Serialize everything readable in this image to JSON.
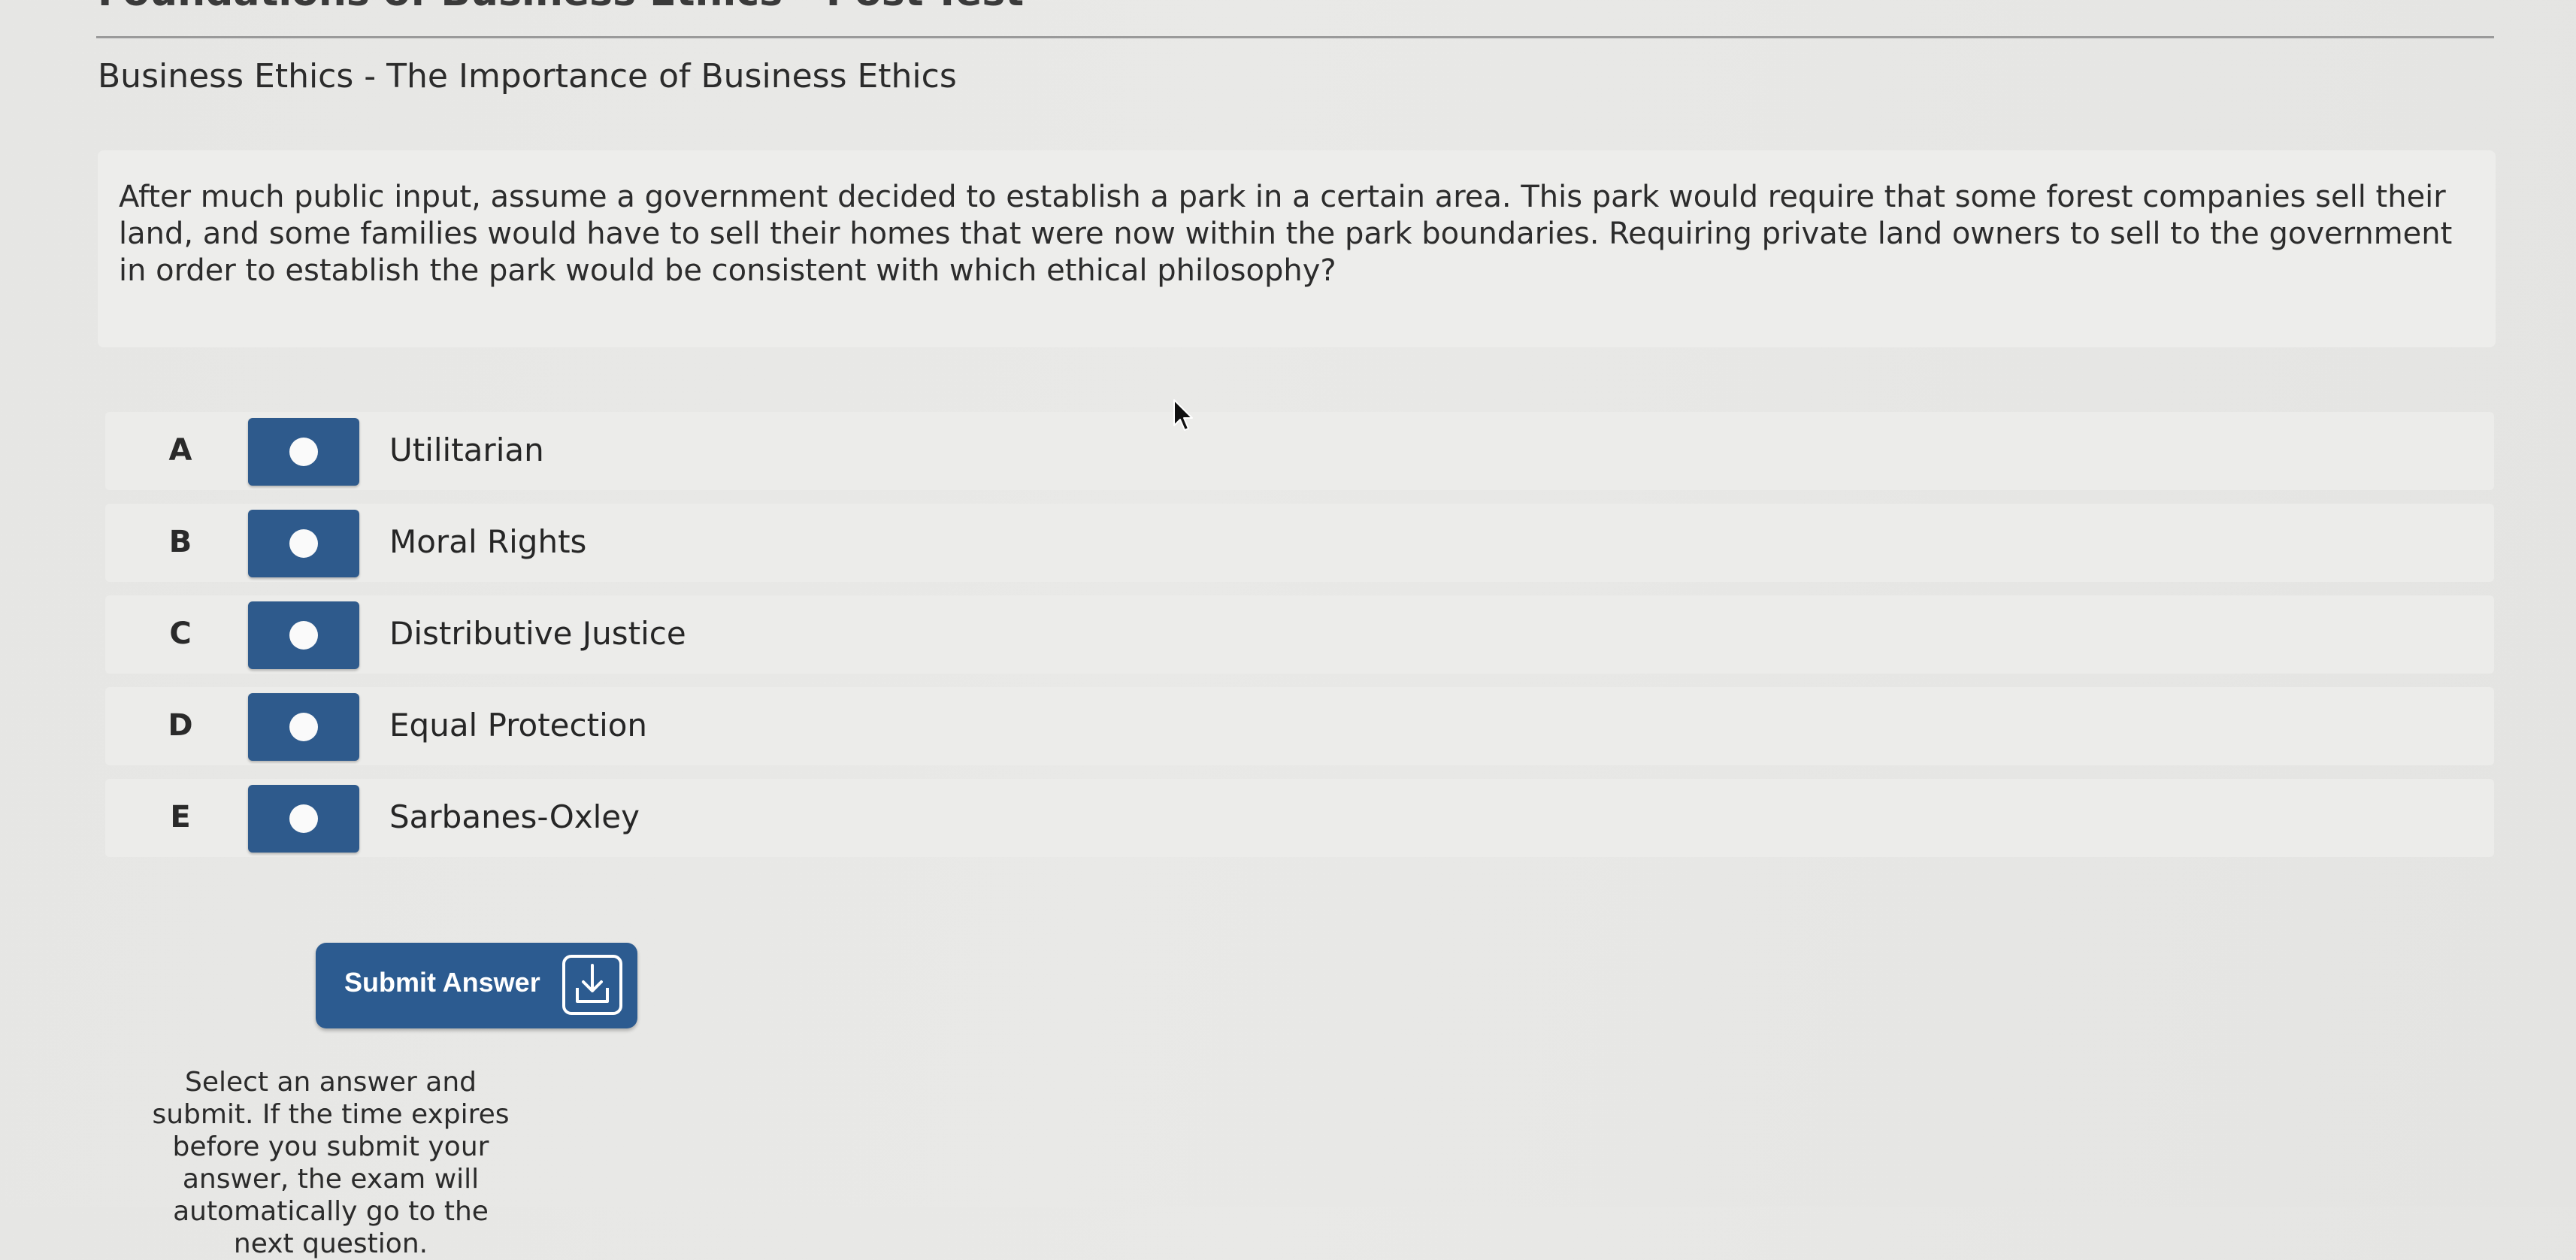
{
  "header": {
    "exam_title": "Foundations of Business Ethics - Post-Test",
    "section_title": "Business Ethics - The Importance of Business Ethics"
  },
  "question": {
    "text": "After much public input, assume a government decided to establish a park in a certain area. This park would require that some forest companies sell their land, and some families would have to sell their homes that were now within the park boundaries. Requiring private land owners to sell to the government in order to establish the park would be consistent with which ethical philosophy?"
  },
  "options": [
    {
      "letter": "A",
      "label": "Utilitarian"
    },
    {
      "letter": "B",
      "label": "Moral Rights"
    },
    {
      "letter": "C",
      "label": "Distributive Justice"
    },
    {
      "letter": "D",
      "label": "Equal Protection"
    },
    {
      "letter": "E",
      "label": "Sarbanes-Oxley"
    }
  ],
  "submit": {
    "label": "Submit Answer",
    "icon": "download-tray-icon"
  },
  "instructions": "Select an answer and submit. If the time expires before you submit your answer, the exam will automatically go to the next question.",
  "colors": {
    "accent": "#2e5a8c",
    "background": "#e8e8e6",
    "card": "#ededeb"
  }
}
